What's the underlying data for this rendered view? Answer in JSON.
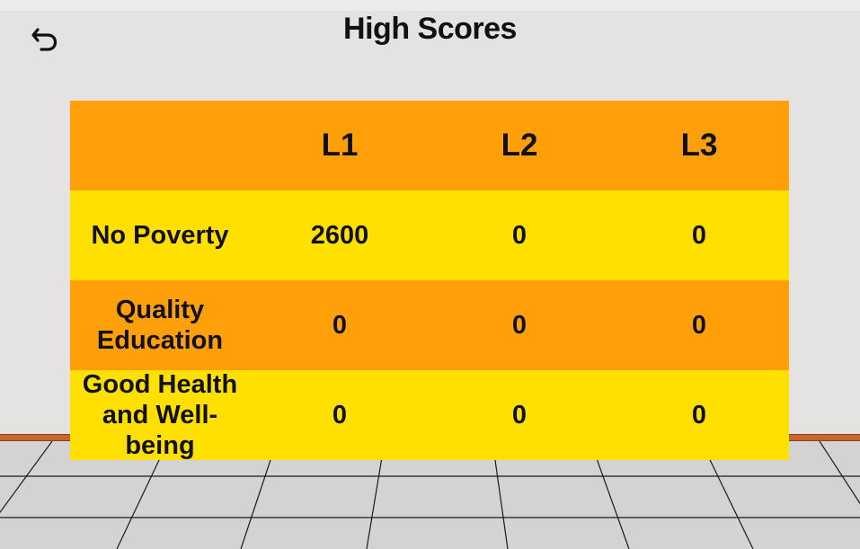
{
  "title": "High Scores",
  "back_icon": "undo-arrow-icon",
  "table": {
    "columns": [
      "",
      "L1",
      "L2",
      "L3"
    ],
    "rows": [
      {
        "label": "No Poverty",
        "scores": [
          "2600",
          "0",
          "0"
        ]
      },
      {
        "label": "Quality Education",
        "scores": [
          "0",
          "0",
          "0"
        ]
      },
      {
        "label": "Good Health and Well-being",
        "scores": [
          "0",
          "0",
          "0"
        ]
      }
    ]
  },
  "colors": {
    "header_row": "#ffa00a",
    "row_yellow": "#ffe000",
    "row_orange": "#ffa00a",
    "wall": "#e4e3e1",
    "baseboard": "#c8642c",
    "floor": "#d3d3d3"
  }
}
